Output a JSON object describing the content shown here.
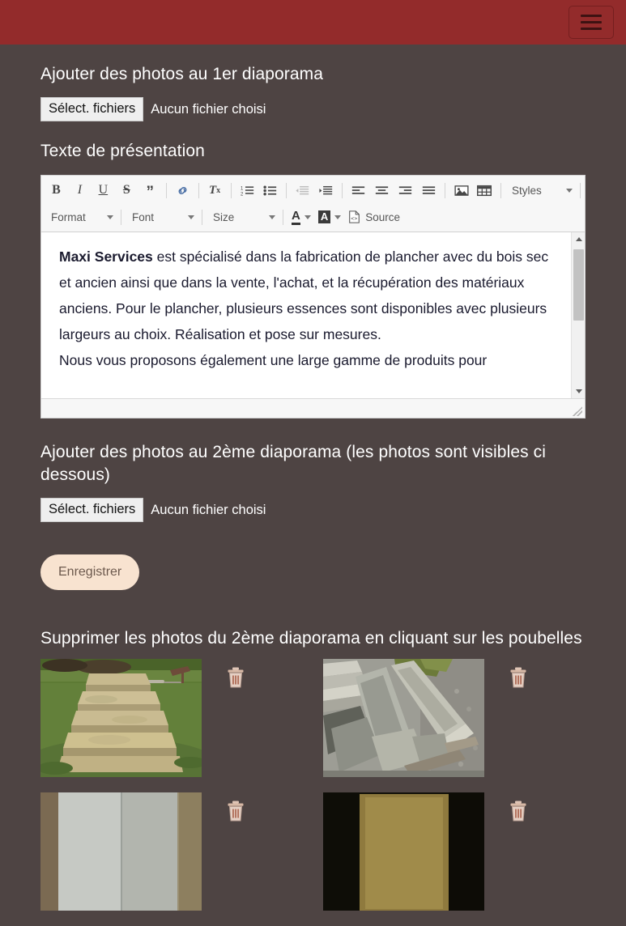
{
  "navbar": {
    "toggle_label": "Toggle navigation",
    "bg_color": "#932b2b"
  },
  "page": {
    "bg_color": "#4e4443",
    "text_color": "#ffffff"
  },
  "slideshow1": {
    "heading": "Ajouter des photos au 1er diaporama",
    "file_button_label": "Sélect. fichiers",
    "file_status": "Aucun fichier choisi"
  },
  "presentation": {
    "heading": "Texte de présentation",
    "toolbar": {
      "bold": "B",
      "italic": "I",
      "underline": "U",
      "strike": "S",
      "blockquote": "”",
      "link": "link-icon",
      "remove_format": "Tx",
      "numbered_list": "numbered-list-icon",
      "bulleted_list": "bulleted-list-icon",
      "outdent": "outdent-icon",
      "indent": "indent-icon",
      "align_left": "align-left-icon",
      "align_center": "align-center-icon",
      "align_right": "align-right-icon",
      "align_justify": "align-justify-icon",
      "image": "image-icon",
      "table": "table-icon",
      "styles_label": "Styles",
      "format_label": "Format",
      "font_label": "Font",
      "size_label": "Size",
      "text_color": "A",
      "bg_color": "A",
      "source_label": "Source"
    },
    "body": {
      "paragraph1_bold": "Maxi Services",
      "paragraph1_rest": " est spécialisé dans la fabrication de plancher avec du bois sec et ancien ainsi que dans la vente, l'achat, et la récupération des matériaux anciens. Pour le plancher, plusieurs essences sont disponibles avec plusieurs largeurs au choix. Réalisation et pose sur mesures.",
      "paragraph2": "Nous vous proposons également une large gamme de produits pour"
    }
  },
  "slideshow2": {
    "heading": "Ajouter des photos au 2ème diaporama (les photos sont visibles ci dessous)",
    "file_button_label": "Sélect. fichiers",
    "file_status": "Aucun fichier choisi"
  },
  "save": {
    "label": "Enregistrer",
    "bg_color": "#f8e3d0",
    "text_color": "#6d5a4e"
  },
  "delete_section": {
    "heading": "Supprimer les photos du 2ème diaporama en cliquant sur les poubelles",
    "photos": [
      {
        "alt": "Marches en pierre empilées sur l'herbe",
        "kind": "stone-steps-grass",
        "delete_label": "trash-icon"
      },
      {
        "alt": "Linteaux en pierre sur une palette",
        "kind": "stone-lintels-gravel",
        "delete_label": "trash-icon"
      },
      {
        "alt": "Dalles en pierre claires",
        "kind": "stone-slabs",
        "delete_label": "trash-icon"
      },
      {
        "alt": "Poutre en bois ancienne",
        "kind": "wood-beam-dark",
        "delete_label": "trash-icon"
      }
    ]
  }
}
